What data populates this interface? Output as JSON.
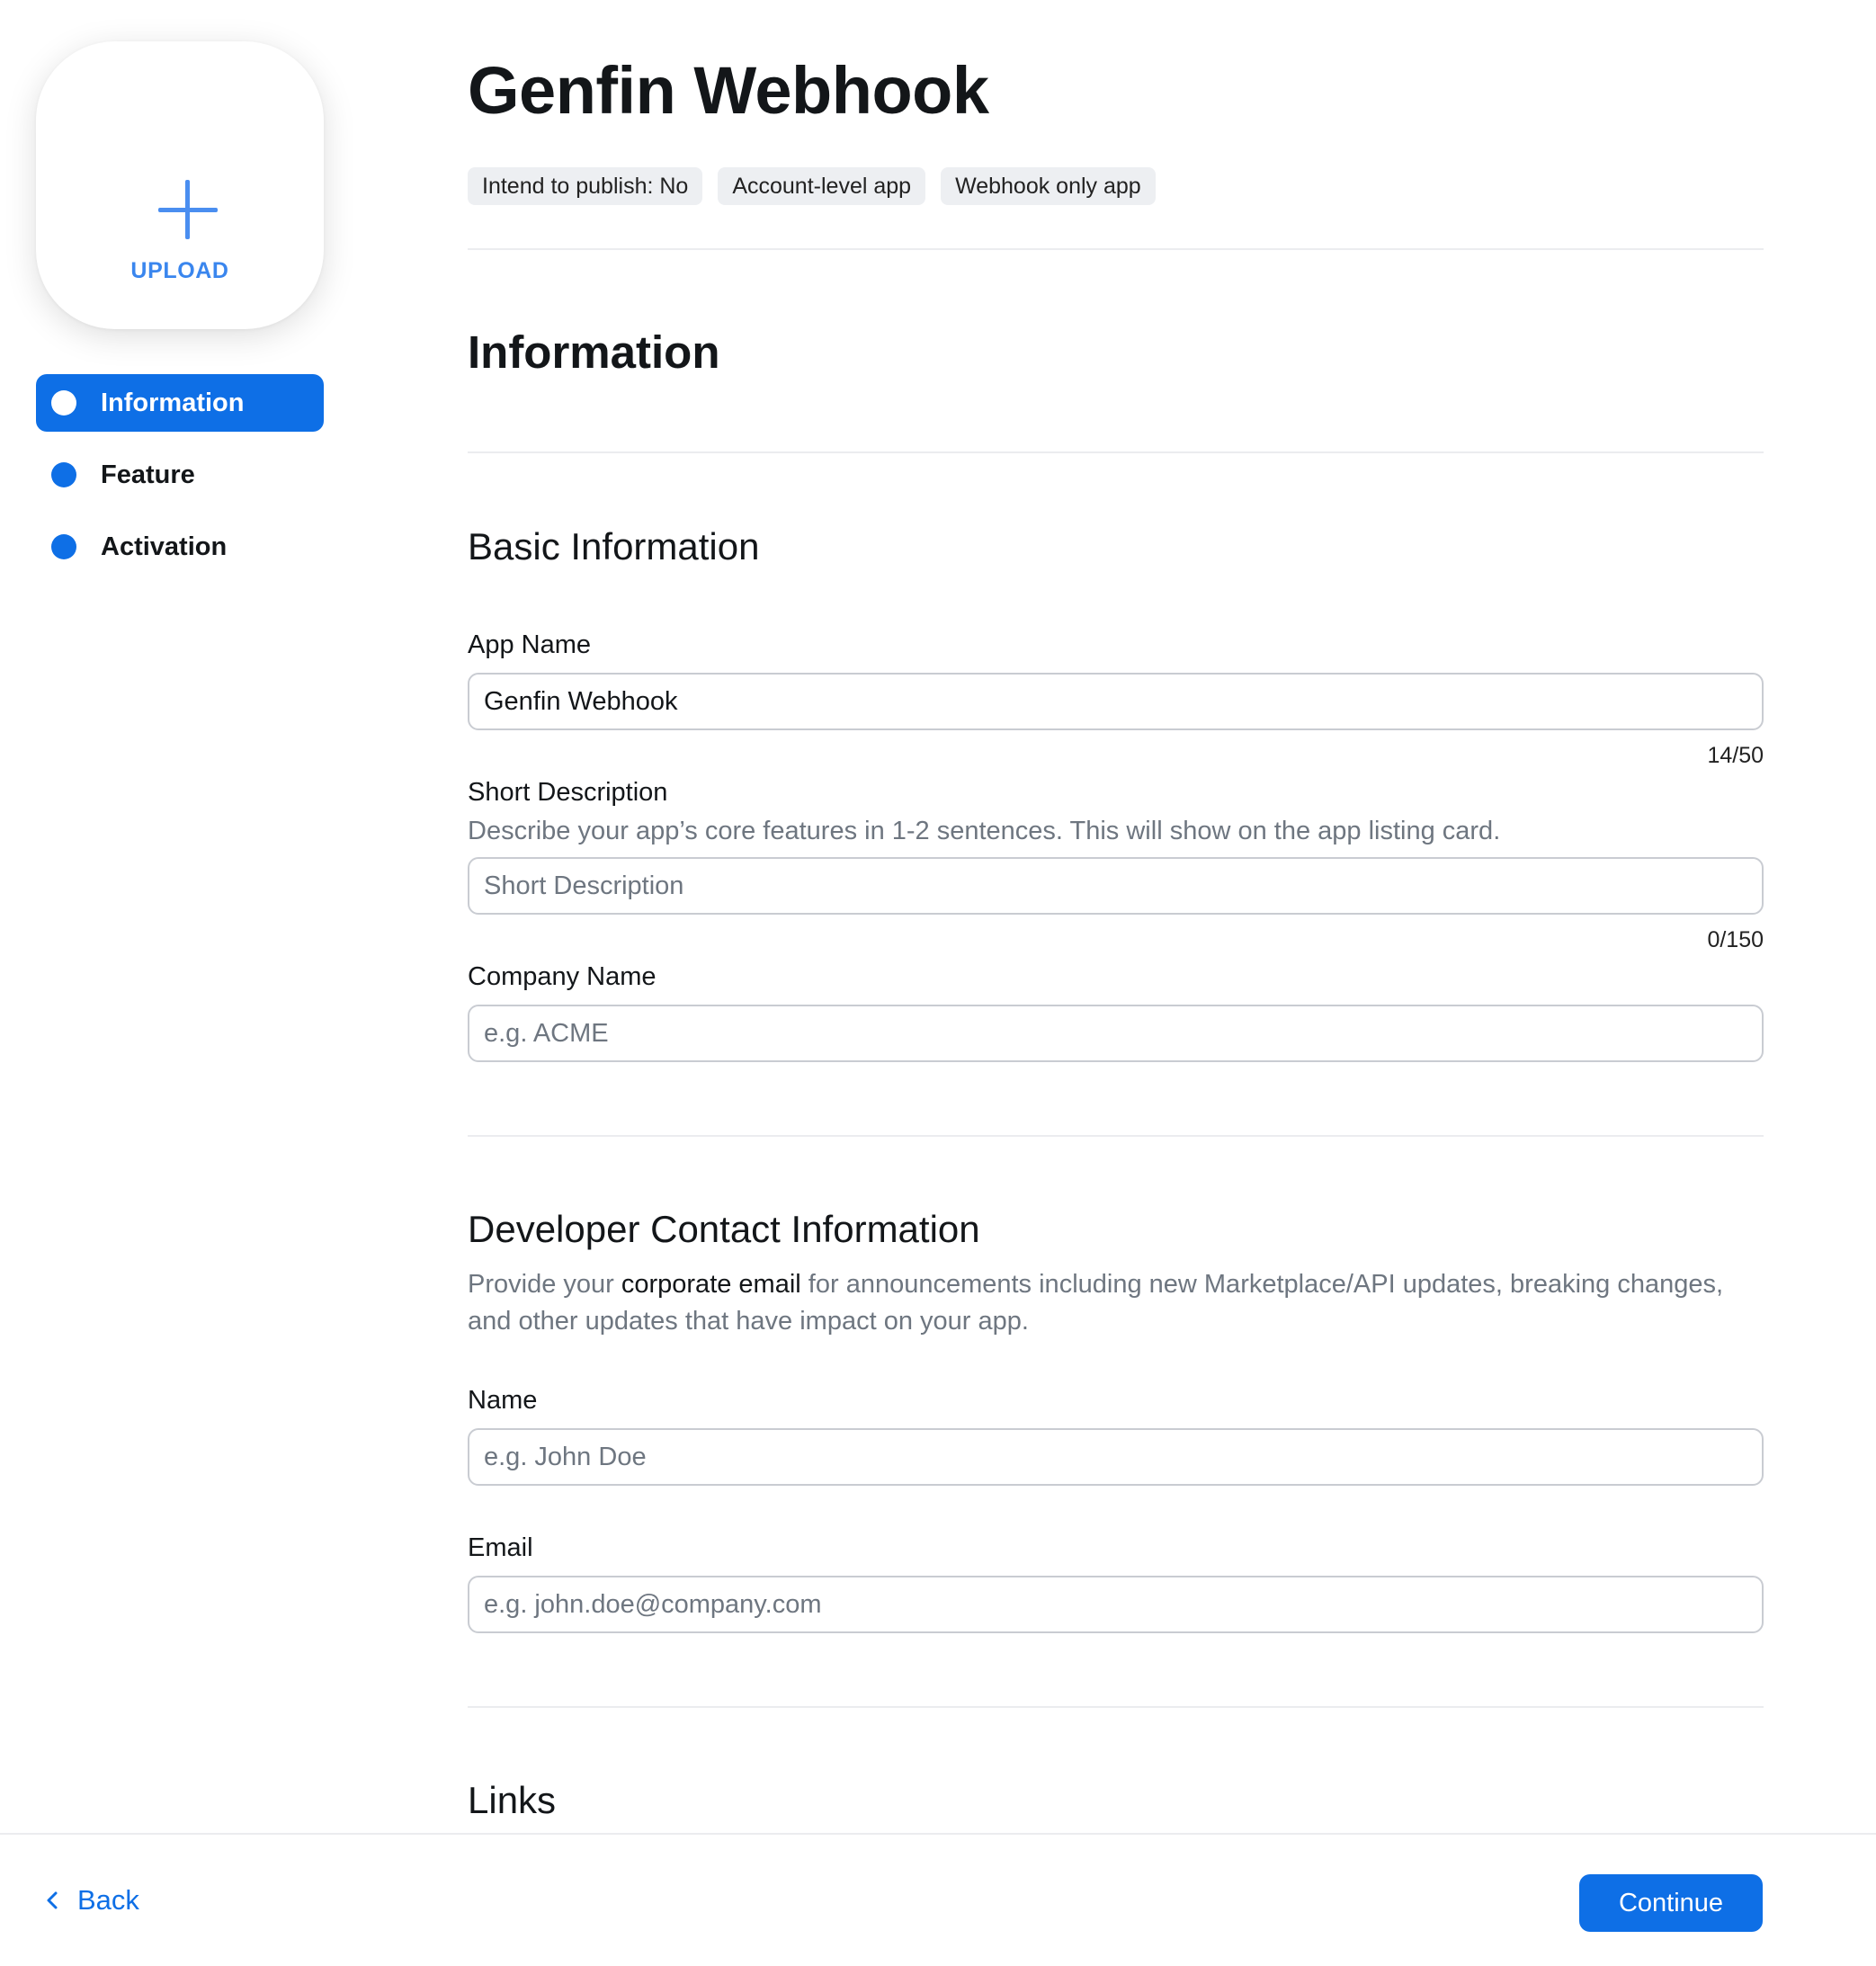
{
  "app": {
    "title": "Genfin Webhook",
    "tags": [
      "Intend to publish: No",
      "Account-level app",
      "Webhook only app"
    ]
  },
  "upload": {
    "label": "UPLOAD",
    "icon": "plus-icon"
  },
  "sidebar": {
    "items": [
      {
        "label": "Information",
        "active": true
      },
      {
        "label": "Feature",
        "active": false
      },
      {
        "label": "Activation",
        "active": false
      }
    ]
  },
  "section": {
    "title": "Information"
  },
  "basic_info": {
    "title": "Basic Information",
    "app_name": {
      "label": "App Name",
      "value": "Genfin Webhook",
      "counter": "14/50"
    },
    "short_description": {
      "label": "Short Description",
      "hint": "Describe your app’s core features in 1-2 sentences. This will show on the app listing card.",
      "placeholder": "Short Description",
      "counter": "0/150"
    },
    "company_name": {
      "label": "Company Name",
      "placeholder": "e.g. ACME"
    }
  },
  "developer_contact": {
    "title": "Developer Contact Information",
    "hint_before": "Provide your ",
    "hint_emphasis": "corporate email",
    "hint_after": " for announcements including new Marketplace/API updates, breaking changes, and other updates that have impact on your app.",
    "name": {
      "label": "Name",
      "placeholder": "e.g. John Doe"
    },
    "email": {
      "label": "Email",
      "placeholder": "e.g. john.doe@company.com"
    }
  },
  "links": {
    "title": "Links"
  },
  "footer": {
    "back_label": "Back",
    "continue_label": "Continue"
  },
  "colors": {
    "accent": "#0e6fe6",
    "upload_accent": "#3a86ee",
    "tag_bg": "#edeff2",
    "hint_text": "#6e7680"
  }
}
